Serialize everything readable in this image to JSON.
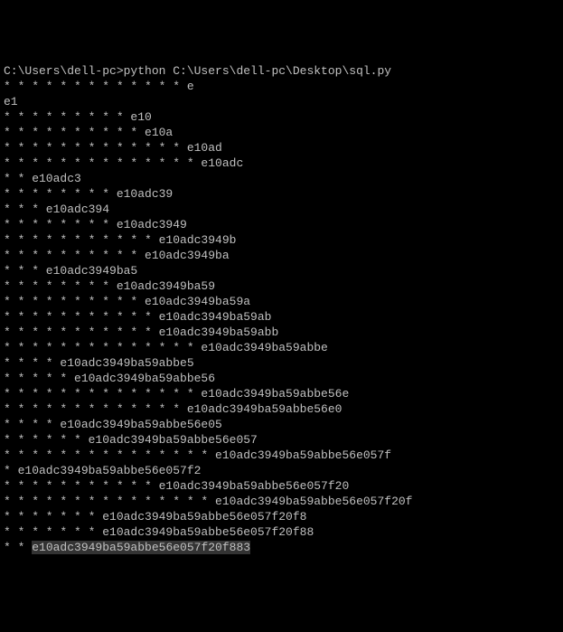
{
  "terminal": {
    "command": "C:\\Users\\dell-pc>python C:\\Users\\dell-pc\\Desktop\\sql.py",
    "lines": [
      "* * * * * * * * * * * * * e",
      "e1",
      "* * * * * * * * * e10",
      "* * * * * * * * * * e10a",
      "* * * * * * * * * * * * * e10ad",
      "* * * * * * * * * * * * * * e10adc",
      "* * e10adc3",
      "* * * * * * * * e10adc39",
      "* * * e10adc394",
      "* * * * * * * * e10adc3949",
      "* * * * * * * * * * * e10adc3949b",
      "* * * * * * * * * * e10adc3949ba",
      "* * * e10adc3949ba5",
      "* * * * * * * * e10adc3949ba59",
      "* * * * * * * * * * e10adc3949ba59a",
      "* * * * * * * * * * * e10adc3949ba59ab",
      "* * * * * * * * * * * e10adc3949ba59abb",
      "* * * * * * * * * * * * * * e10adc3949ba59abbe",
      "* * * * e10adc3949ba59abbe5",
      "* * * * * e10adc3949ba59abbe56",
      "* * * * * * * * * * * * * * e10adc3949ba59abbe56e",
      "* * * * * * * * * * * * * e10adc3949ba59abbe56e0",
      "* * * * e10adc3949ba59abbe56e05",
      "* * * * * * e10adc3949ba59abbe56e057",
      "* * * * * * * * * * * * * * * e10adc3949ba59abbe56e057f",
      "* e10adc3949ba59abbe56e057f2",
      "* * * * * * * * * * * e10adc3949ba59abbe56e057f20",
      "* * * * * * * * * * * * * * * e10adc3949ba59abbe56e057f20f",
      "* * * * * * * e10adc3949ba59abbe56e057f20f8",
      "* * * * * * * e10adc3949ba59abbe56e057f20f88",
      "* * e10adc3949ba59abbe56e057f20f883"
    ],
    "highlighted_line_index": 30
  }
}
